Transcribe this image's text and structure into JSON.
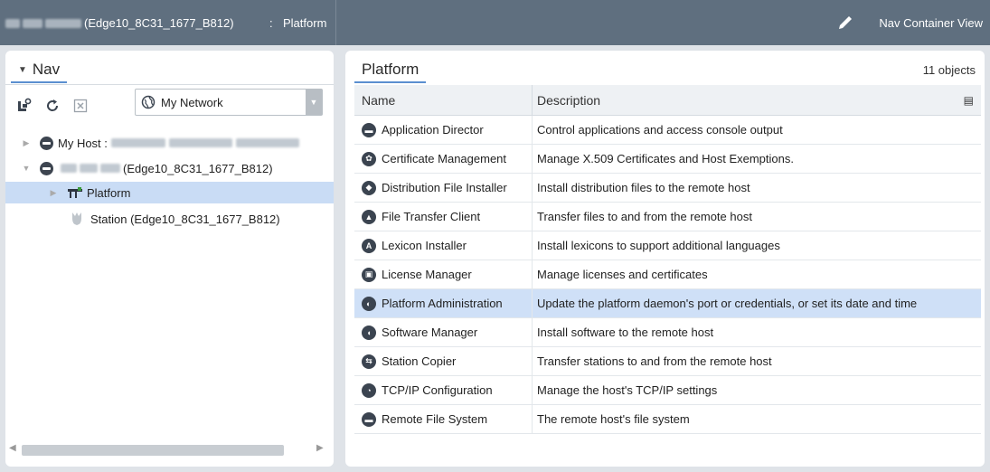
{
  "header": {
    "host_label": "(Edge10_8C31_1677_B812)",
    "separator": ":",
    "current_location": "Platform",
    "view_name": "Nav Container View"
  },
  "nav": {
    "tab_label": "Nav",
    "network_select": "My Network",
    "tree": [
      {
        "label": "My Host :"
      },
      {
        "label": "(Edge10_8C31_1677_B812)"
      },
      {
        "label": "Platform"
      },
      {
        "label": "Station (Edge10_8C31_1677_B812)"
      }
    ]
  },
  "main": {
    "tab_label": "Platform",
    "object_count": "11 objects",
    "columns": {
      "name": "Name",
      "description": "Description"
    },
    "rows": [
      {
        "name": "Application Director",
        "description": "Control applications and access console output",
        "icon": "app-director-icon"
      },
      {
        "name": "Certificate Management",
        "description": "Manage X.509 Certificates and Host Exemptions.",
        "icon": "certificate-icon"
      },
      {
        "name": "Distribution File Installer",
        "description": "Install distribution files to the remote host",
        "icon": "distribution-icon"
      },
      {
        "name": "File Transfer Client",
        "description": "Transfer files to and from the remote host",
        "icon": "file-transfer-icon"
      },
      {
        "name": "Lexicon Installer",
        "description": "Install lexicons to support additional languages",
        "icon": "lexicon-icon"
      },
      {
        "name": "License Manager",
        "description": "Manage licenses and certificates",
        "icon": "license-icon"
      },
      {
        "name": "Platform Administration",
        "description": "Update the platform daemon's port or credentials, or set its date and time",
        "icon": "platform-admin-icon",
        "selected": true
      },
      {
        "name": "Software Manager",
        "description": "Install software to the remote host",
        "icon": "software-manager-icon"
      },
      {
        "name": "Station Copier",
        "description": "Transfer stations to and from the remote host",
        "icon": "station-copier-icon"
      },
      {
        "name": "TCP/IP Configuration",
        "description": "Manage the host's TCP/IP settings",
        "icon": "tcpip-icon"
      },
      {
        "name": "Remote File System",
        "description": "The remote host's file system",
        "icon": "remote-fs-icon"
      }
    ]
  },
  "colors": {
    "header_bg": "#5f6f7f",
    "selection": "#cfe0f7",
    "tab_underline": "#5b8fd0"
  }
}
